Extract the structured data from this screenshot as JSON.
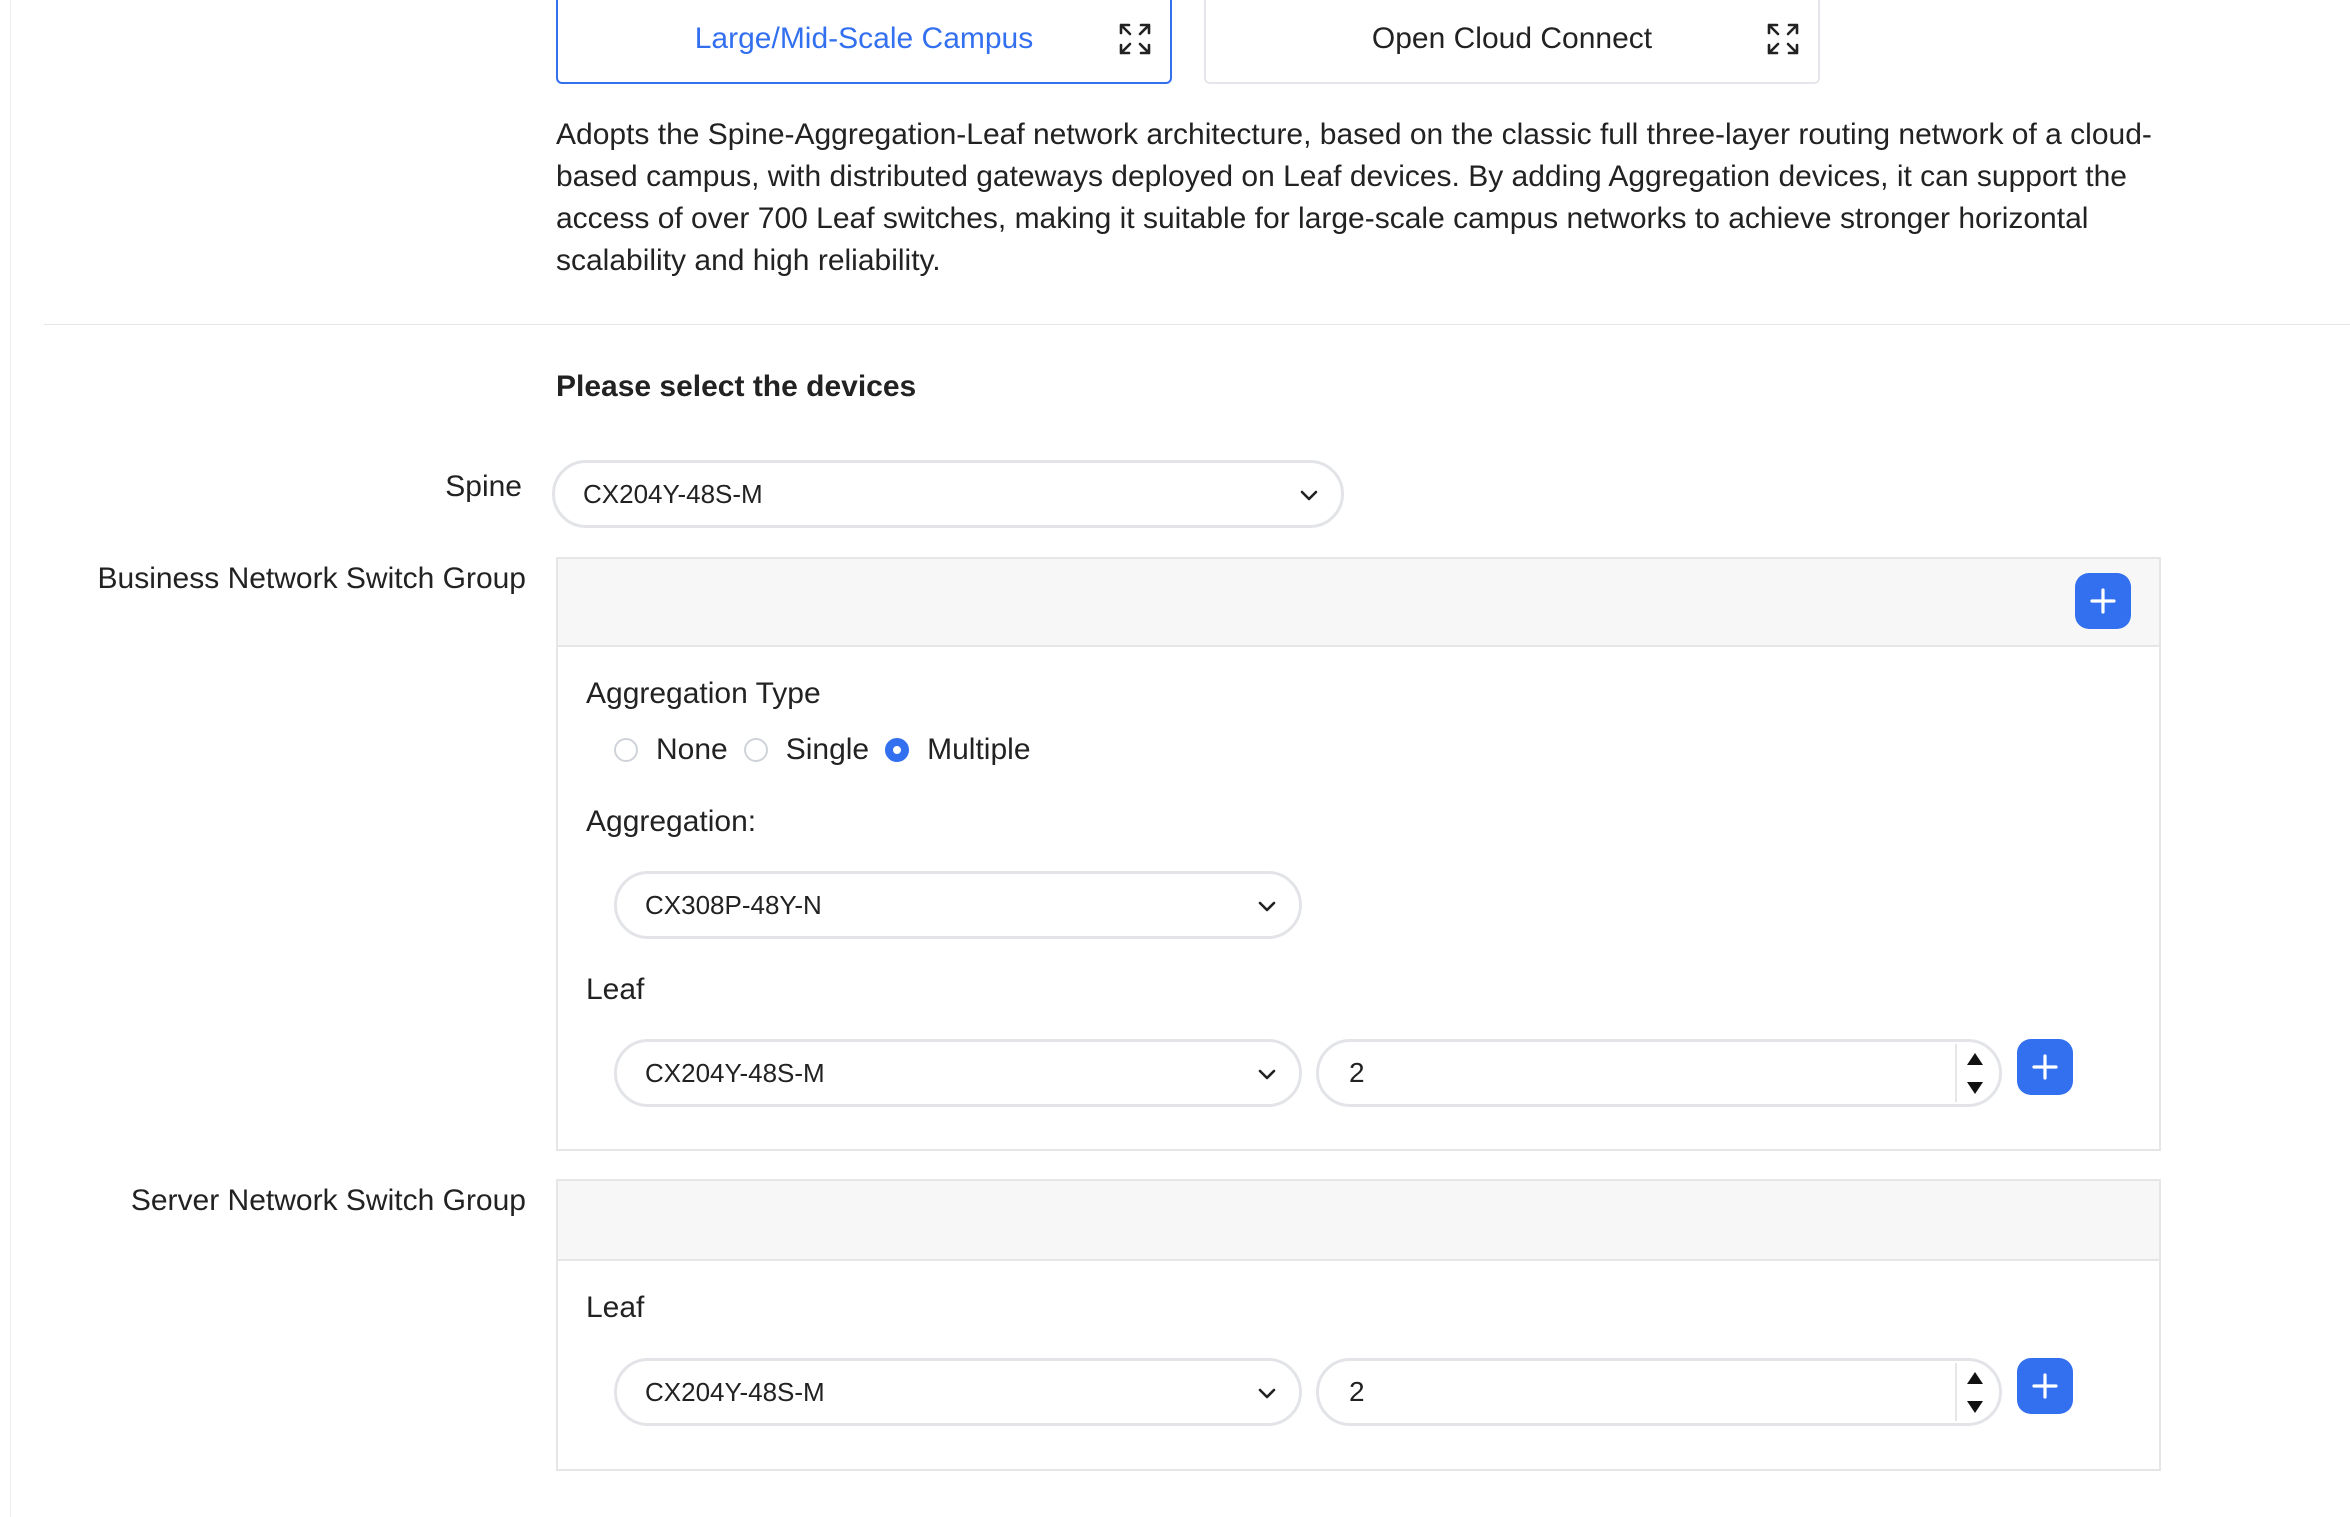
{
  "tabs": [
    {
      "label": "Large/Mid-Scale Campus",
      "active": true,
      "icon": "expand-icon"
    },
    {
      "label": "Open Cloud Connect",
      "active": false,
      "icon": "expand-icon"
    }
  ],
  "description": "Adopts the Spine-Aggregation-Leaf network architecture, based on the classic full three-layer routing network of a cloud-based campus, with distributed gateways deployed on Leaf devices. By adding Aggregation devices, it can support the access of over 700 Leaf switches, making it suitable for large-scale campus networks to achieve stronger horizontal scalability and high reliability.",
  "section_title": "Please select the devices",
  "spine": {
    "label": "Spine",
    "value": "CX204Y-48S-M"
  },
  "business_group": {
    "label": "Business Network Switch Group",
    "aggregation_type_label": "Aggregation Type",
    "aggregation_type_options": [
      {
        "label": "None",
        "checked": false
      },
      {
        "label": "Single",
        "checked": false
      },
      {
        "label": "Multiple",
        "checked": true
      }
    ],
    "aggregation_label": "Aggregation:",
    "aggregation_value": "CX308P-48Y-N",
    "leaf_label": "Leaf",
    "leaf_value": "CX204Y-48S-M",
    "leaf_count": "2"
  },
  "server_group": {
    "label": "Server Network Switch Group",
    "leaf_label": "Leaf",
    "leaf_value": "CX204Y-48S-M",
    "leaf_count": "2"
  },
  "colors": {
    "accent": "#3370f0",
    "border": "#e2e4e8",
    "header_bg": "#f7f7f7"
  }
}
